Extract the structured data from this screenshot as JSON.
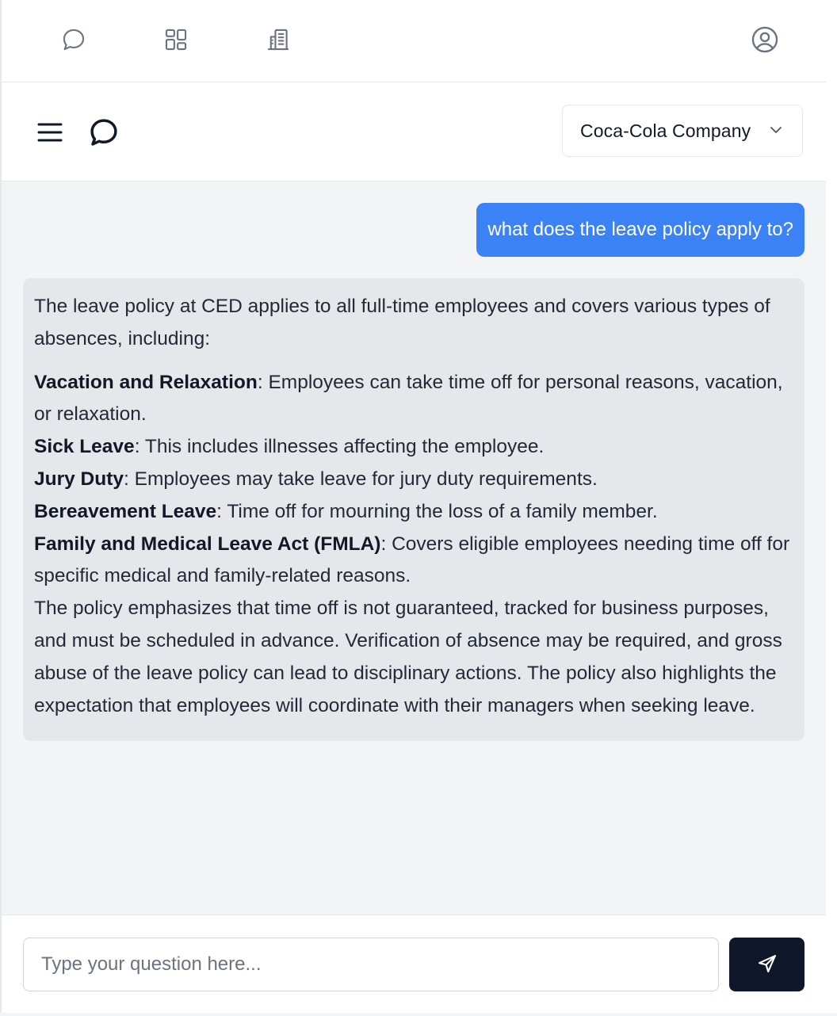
{
  "topnav": {
    "icons": [
      "chat-bubble-icon",
      "grid-icon",
      "building-icon",
      "user-circle-icon"
    ]
  },
  "header": {
    "menu_icon": "hamburger-menu-icon",
    "chat_icon": "chat-bubble-icon",
    "company_select": {
      "value": "Coca-Cola Company",
      "icon": "chevron-down-icon"
    }
  },
  "chat": {
    "user_message": "what does the leave policy apply to?",
    "bot_message": {
      "intro": "The leave policy at CED applies to all full-time employees and covers various types of absences, including:",
      "items": [
        {
          "term": "Vacation and Relaxation",
          "text": ": Employees can take time off for personal reasons, vacation, or relaxation."
        },
        {
          "term": "Sick Leave",
          "text": ": This includes illnesses affecting the employee."
        },
        {
          "term": "Jury Duty",
          "text": ": Employees may take leave for jury duty requirements."
        },
        {
          "term": "Bereavement Leave",
          "text": ": Time off for mourning the loss of a family member."
        },
        {
          "term": "Family and Medical Leave Act (FMLA)",
          "text": ": Covers eligible employees needing time off for specific medical and family-related reasons."
        }
      ],
      "summary": "The policy emphasizes that time off is not guaranteed, tracked for business purposes, and must be scheduled in advance. Verification of absence may be required, and gross abuse of the leave policy can lead to disciplinary actions. The policy also highlights the expectation that employees will coordinate with their managers when seeking leave."
    }
  },
  "composer": {
    "value": "",
    "placeholder": "Type your question here...",
    "send_icon": "send-icon"
  },
  "colors": {
    "accent": "#3b82f6",
    "send_button": "#0f172a",
    "chat_background": "#f3f4f6",
    "bot_bubble": "#e5e7eb"
  }
}
